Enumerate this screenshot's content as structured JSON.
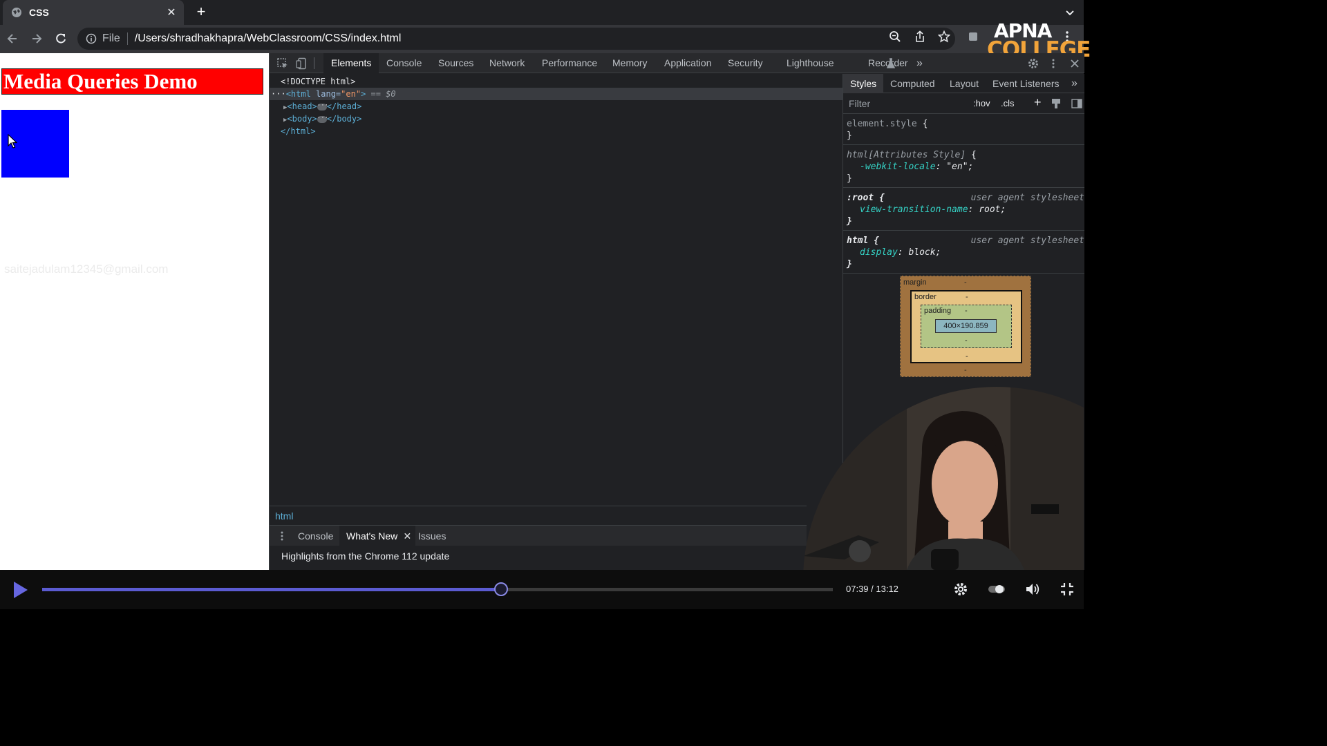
{
  "browser": {
    "tab_title": "CSS",
    "new_tab_label": "+",
    "url_scheme": "File",
    "url_path": "/Users/shradhakhapra/WebClassroom/CSS/index.html"
  },
  "logo": {
    "line1": "APNA",
    "line2": "COLLEGE"
  },
  "page": {
    "heading": "Media Queries Demo",
    "watermark": "saitejadulam12345@gmail.com",
    "colors": {
      "heading_bg": "#ff0000",
      "box_bg": "#0000ff"
    }
  },
  "devtools": {
    "tabs": [
      "Elements",
      "Console",
      "Sources",
      "Network",
      "Performance",
      "Memory",
      "Application",
      "Security",
      "Lighthouse",
      "Recorder"
    ],
    "active_tab": "Elements",
    "dom": {
      "doctype": "<!DOCTYPE html>",
      "html_open_tag": "<html",
      "html_attr_name": " lang=",
      "html_attr_value": "\"en\"",
      "html_open_close": ">",
      "selected_marker": " == $0",
      "head_open": "<head>",
      "head_close": "</head>",
      "body_open": "<body>",
      "body_close": "</body>",
      "html_close": "</html>"
    },
    "styles_tabs": [
      "Styles",
      "Computed",
      "Layout",
      "Event Listeners"
    ],
    "filter_placeholder": "Filter",
    "hov": ":hov",
    "cls": ".cls",
    "rules": {
      "r1_selector": "element.style",
      "r2_selector": "html[Attributes Style]",
      "r2_prop": "-webkit-locale",
      "r2_value": "\"en\"",
      "r3_selector": ":root",
      "r3_origin": "user agent stylesheet",
      "r3_prop": "view-transition-name",
      "r3_value": "root",
      "r4_selector": "html",
      "r4_origin": "user agent stylesheet",
      "r4_prop": "display",
      "r4_value": "block"
    },
    "box_model": {
      "margin_label": "margin",
      "border_label": "border",
      "padding_label": "padding",
      "content_size": "400×190.859",
      "dash": "-"
    },
    "breadcrumb": "html",
    "drawer_tabs": {
      "console": "Console",
      "whats_new": "What's New",
      "issues": "Issues"
    },
    "drawer_message": "Highlights from the Chrome 112 update"
  },
  "player": {
    "time_display": "07:39 / 13:12",
    "progress_fraction": 0.58
  }
}
